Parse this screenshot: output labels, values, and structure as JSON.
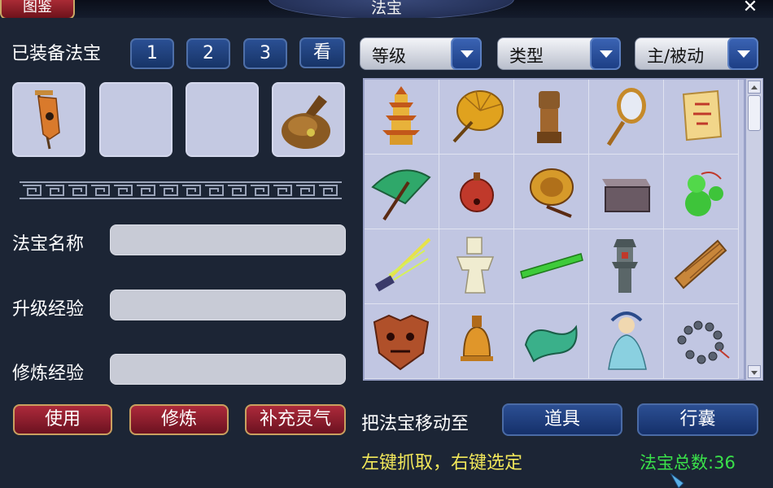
{
  "window": {
    "title": "法宝",
    "tujian_tab": "图鉴",
    "close_glyph": "✕"
  },
  "equipped": {
    "label": "已装备法宝",
    "sets": [
      "1",
      "2",
      "3"
    ],
    "view_button": "看",
    "slots": [
      {
        "item": "banner-flag-icon"
      },
      {
        "item": ""
      },
      {
        "item": ""
      },
      {
        "item": "cloth-pouch-icon"
      }
    ]
  },
  "filters": [
    {
      "label": "等级"
    },
    {
      "label": "类型"
    },
    {
      "label": "主/被动"
    }
  ],
  "fields": {
    "name_label": "法宝名称",
    "upgrade_label": "升级经验",
    "cultivate_label": "修炼经验"
  },
  "actions": {
    "use": "使用",
    "cultivate": "修炼",
    "replenish": "补充灵气",
    "move_to_label": "把法宝移动至",
    "to_items": "道具",
    "to_bag": "行囊"
  },
  "hint": "左键抓取，右键选定",
  "total": {
    "label": "法宝总数:",
    "count": "36"
  },
  "colors": {
    "hint": "#f2e85a",
    "total": "#3ae24a"
  },
  "inventory": [
    "pagoda-icon",
    "palm-leaf-fan-icon",
    "seal-stamp-icon",
    "hand-mirror-icon",
    "scroll-talisman-icon",
    "umbrella-icon",
    "red-bell-icon",
    "golden-drum-icon",
    "treasure-box-icon",
    "green-gourd-icon",
    "thunder-sword-icon",
    "paper-doll-icon",
    "jade-ruler-icon",
    "stone-lantern-icon",
    "bamboo-scroll-icon",
    "demon-mask-icon",
    "bronze-bell-icon",
    "jade-dragon-icon",
    "goddess-figure-icon",
    "prayer-beads-icon"
  ]
}
